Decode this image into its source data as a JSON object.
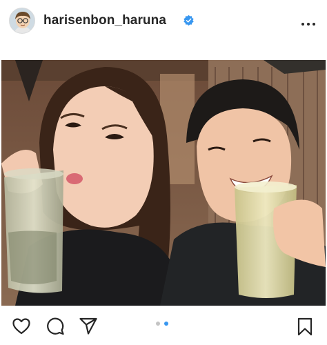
{
  "post": {
    "username": "harisenbon_haruna",
    "verified": true
  },
  "icons": {
    "avatar": "cartoon-avatar",
    "verified": "verified-badge-icon",
    "more": "more-options-icon",
    "like": "heart-icon",
    "comment": "comment-icon",
    "share": "send-icon",
    "save": "bookmark-icon"
  },
  "carousel": {
    "total": 2,
    "current": 2
  },
  "colors": {
    "verified_badge": "#3897f0",
    "active_dot": "#3897f0",
    "inactive_dot": "#c4c4c4",
    "text": "#262626"
  }
}
